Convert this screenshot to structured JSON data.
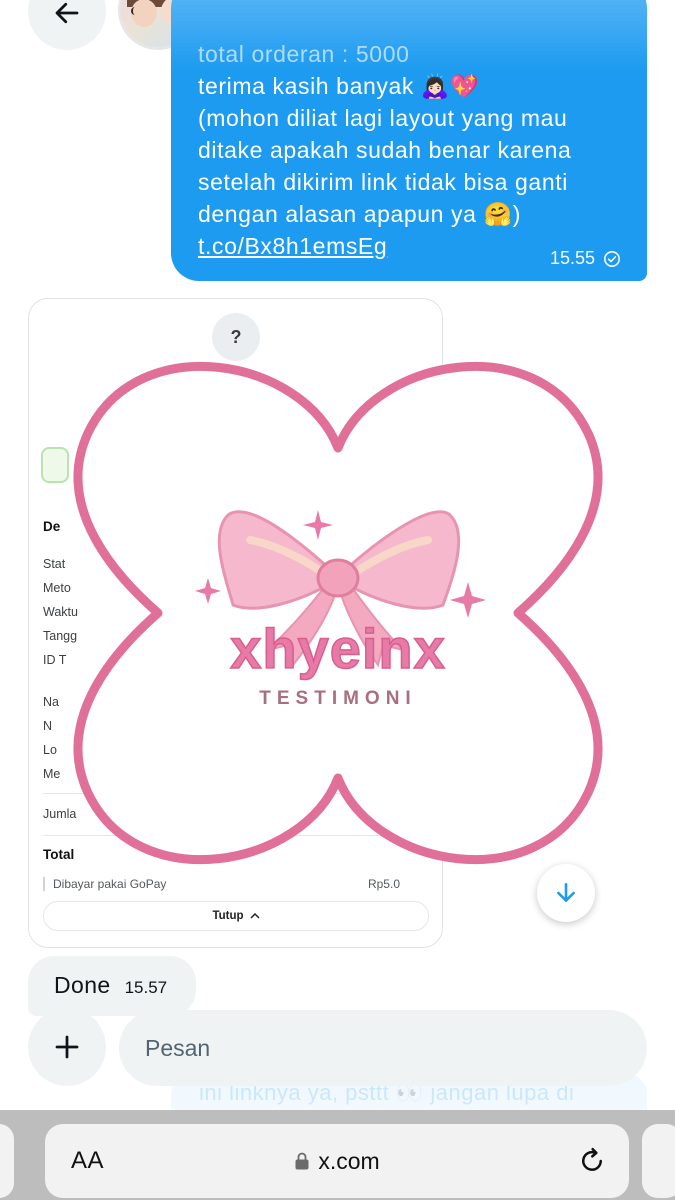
{
  "header": {
    "back_icon": "arrow-left-icon",
    "avatar": "avatar-photo"
  },
  "outgoing_message": {
    "faded_line": "total orderan : 5000",
    "lines": [
      "terima kasih banyak 🙇🏻‍♀️💖",
      "(mohon diliat lagi layout yang mau",
      "ditake apakah sudah benar karena",
      "setelah dikirim link tidak bisa ganti",
      "dengan alasan apapun ya 🤗)"
    ],
    "link": "t.co/Bx8h1emsEg",
    "time": "15.55",
    "status_icon": "sent-check-icon"
  },
  "image_card": {
    "help": "?",
    "rows": [
      "De",
      "Stat",
      "Meto",
      "Waktu",
      "Tangg",
      "ID T",
      "Na",
      "N",
      "Lo",
      "Me",
      "Jumla"
    ],
    "total_label": "Total",
    "paid_with": "Dibayar pakai GoPay",
    "amount": "Rp5.0",
    "close_label": "Tutup",
    "logo_title": "xhyeinx",
    "logo_subtitle": "TESTIMONI"
  },
  "incoming_message": {
    "text": "Done",
    "time": "15.57"
  },
  "composer": {
    "placeholder": "Pesan",
    "add_icon": "plus-icon",
    "ghost_text": "ini linknya ya, psttt 👀 jangan lupa di"
  },
  "browser": {
    "text_size_label": "AA",
    "url": "x.com",
    "lock_icon": "lock-icon",
    "reload_icon": "reload-icon"
  },
  "colors": {
    "accent": "#1d9bf0",
    "bubble_gray": "#eff3f4",
    "flower_border": "#e07097",
    "logo_pink": "#e87aa8"
  }
}
